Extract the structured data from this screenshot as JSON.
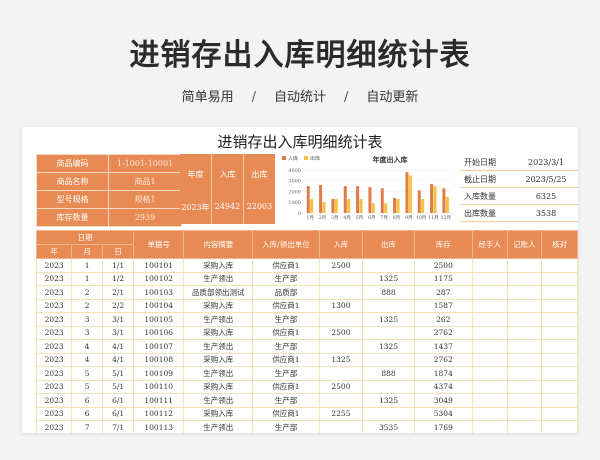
{
  "banner": {
    "title": "进销存出入库明细统计表",
    "tags": [
      "简单易用",
      "自动统计",
      "自动更新"
    ],
    "separator": "/"
  },
  "sheet": {
    "title": "进销存出入库明细统计表",
    "info": [
      {
        "label": "商品编码",
        "value": "1-1001-10001"
      },
      {
        "label": "商品名称",
        "value": "商品1"
      },
      {
        "label": "型号规格",
        "value": "规格1"
      },
      {
        "label": "库存数量",
        "value": "2939"
      }
    ],
    "summary": {
      "year_label": "年度",
      "in_label": "入库",
      "out_label": "出库",
      "year": "2023年",
      "in_value": "24942",
      "out_value": "22003"
    },
    "right_info": [
      {
        "label": "开始日期",
        "value": "2023/3/1"
      },
      {
        "label": "截止日期",
        "value": "2023/5/25"
      },
      {
        "label": "入库数量",
        "value": "6325"
      },
      {
        "label": "出库数量",
        "value": "3538"
      }
    ],
    "columns": {
      "date": "日期",
      "year": "年",
      "month": "月",
      "day": "日",
      "doc_no": "单据号",
      "summary": "内容摘要",
      "unit": "入库/领出单位",
      "in": "入库",
      "out": "出库",
      "stock": "库存",
      "handler": "经手人",
      "recorder": "记账人",
      "check": "核对"
    },
    "rows": [
      [
        "2023",
        "1",
        "1/1",
        "100101",
        "采购入库",
        "供应商1",
        "2500",
        "",
        "2500"
      ],
      [
        "2023",
        "1",
        "1/2",
        "100102",
        "生产领出",
        "生产部",
        "",
        "1325",
        "1175"
      ],
      [
        "2023",
        "2",
        "2/1",
        "100103",
        "品质部领出测试",
        "品质部",
        "",
        "888",
        "287"
      ],
      [
        "2023",
        "2",
        "2/2",
        "100104",
        "采购入库",
        "供应商1",
        "1300",
        "",
        "1587"
      ],
      [
        "2023",
        "3",
        "3/1",
        "100105",
        "生产领出",
        "生产部",
        "",
        "1325",
        "262"
      ],
      [
        "2023",
        "3",
        "3/1",
        "100106",
        "采购入库",
        "供应商1",
        "2500",
        "",
        "2762"
      ],
      [
        "2023",
        "4",
        "4/1",
        "100107",
        "生产领出",
        "生产部",
        "",
        "1325",
        "1437"
      ],
      [
        "2023",
        "4",
        "4/1",
        "100108",
        "采购入库",
        "供应商1",
        "1325",
        "",
        "2762"
      ],
      [
        "2023",
        "5",
        "5/1",
        "100109",
        "生产领出",
        "生产部",
        "",
        "888",
        "1874"
      ],
      [
        "2023",
        "5",
        "5/1",
        "100110",
        "采购入库",
        "供应商1",
        "2500",
        "",
        "4374"
      ],
      [
        "2023",
        "6",
        "6/1",
        "100111",
        "生产领出",
        "生产部",
        "",
        "1325",
        "3049"
      ],
      [
        "2023",
        "6",
        "6/1",
        "100112",
        "采购入库",
        "供应商1",
        "2255",
        "",
        "5304"
      ],
      [
        "2023",
        "7",
        "7/1",
        "100113",
        "生产领出",
        "生产部",
        "",
        "3535",
        "1769"
      ]
    ]
  },
  "chart_data": {
    "type": "bar",
    "title": "年度出入库",
    "categories": [
      "1月",
      "2月",
      "3月",
      "4月",
      "5月",
      "6月",
      "7月",
      "8月",
      "9月",
      "10月",
      "11月",
      "12月"
    ],
    "series": [
      {
        "name": "入库",
        "color": "#e07b4a",
        "values": [
          2500,
          2600,
          1300,
          2500,
          2500,
          2400,
          2300,
          1400,
          3800,
          2100,
          2700,
          2300
        ]
      },
      {
        "name": "出库",
        "color": "#f5c13e",
        "values": [
          1300,
          1000,
          1300,
          1300,
          1300,
          900,
          900,
          1300,
          3500,
          1300,
          2500,
          1500
        ]
      }
    ],
    "yticks": [
      "4000",
      "3000",
      "2000",
      "1000",
      "0"
    ],
    "ylim": [
      0,
      4000
    ],
    "legend": "top-left"
  }
}
